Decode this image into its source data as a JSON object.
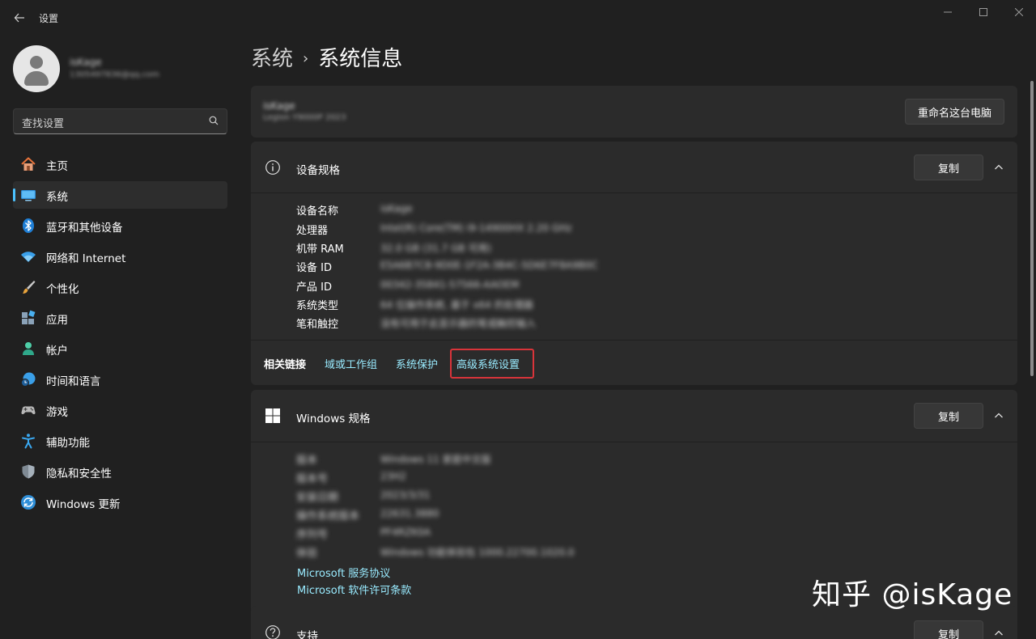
{
  "window": {
    "title": "设置",
    "minimize": "—",
    "maximize": "☐",
    "close": "✕"
  },
  "user": {
    "name": "isKage",
    "email": "1305497836@qq.com"
  },
  "search": {
    "placeholder": "查找设置"
  },
  "nav": [
    {
      "label": "主页",
      "icon": "home-icon"
    },
    {
      "label": "系统",
      "icon": "system-icon",
      "selected": true
    },
    {
      "label": "蓝牙和其他设备",
      "icon": "bluetooth-icon"
    },
    {
      "label": "网络和 Internet",
      "icon": "wifi-icon"
    },
    {
      "label": "个性化",
      "icon": "brush-icon"
    },
    {
      "label": "应用",
      "icon": "apps-icon"
    },
    {
      "label": "帐户",
      "icon": "account-icon"
    },
    {
      "label": "时间和语言",
      "icon": "globe-clock-icon"
    },
    {
      "label": "游戏",
      "icon": "gamepad-icon"
    },
    {
      "label": "辅助功能",
      "icon": "accessibility-icon"
    },
    {
      "label": "隐私和安全性",
      "icon": "shield-icon"
    },
    {
      "label": "Windows 更新",
      "icon": "update-icon"
    }
  ],
  "breadcrumb": {
    "parent": "系统",
    "separator": "›",
    "current": "系统信息"
  },
  "pc": {
    "name": "isKage",
    "model": "Legion Y9000P 2023",
    "rename_button": "重命名这台电脑"
  },
  "device_specs": {
    "title": "设备规格",
    "copy_button": "复制",
    "rows": [
      {
        "label": "设备名称",
        "value": "isKage"
      },
      {
        "label": "处理器",
        "value": "Intel(R) Core(TM) i9-14900HX   2.20 GHz"
      },
      {
        "label": "机带 RAM",
        "value": "32.0 GB (31.7 GB 可用)"
      },
      {
        "label": "设备 ID",
        "value": "E5A6B7C8-9D0E-1F2A-3B4C-5D6E7F8A9B0C"
      },
      {
        "label": "产品 ID",
        "value": "00342-35841-57566-AAOEM"
      },
      {
        "label": "系统类型",
        "value": "64 位操作系统, 基于 x64 的处理器"
      },
      {
        "label": "笔和触控",
        "value": "没有可用于此显示器的笔或触控输入"
      }
    ],
    "related_label": "相关链接",
    "related_links": [
      "域或工作组",
      "系统保护",
      "高级系统设置"
    ]
  },
  "windows_specs": {
    "title": "Windows 规格",
    "copy_button": "复制",
    "rows": [
      {
        "label": "版本",
        "value": "Windows 11 家庭中文版"
      },
      {
        "label": "版本号",
        "value": "23H2"
      },
      {
        "label": "安装日期",
        "value": "2023/3/31"
      },
      {
        "label": "操作系统版本",
        "value": "22631.3880"
      },
      {
        "label": "序列号",
        "value": "PF4RZK0A"
      },
      {
        "label": "体验",
        "value": "Windows 功能体验包 1000.22700.1020.0"
      }
    ],
    "links": [
      "Microsoft 服务协议",
      "Microsoft 软件许可条款"
    ]
  },
  "support": {
    "title": "支持",
    "copy_button": "复制"
  },
  "watermark": "知乎 @isKage"
}
